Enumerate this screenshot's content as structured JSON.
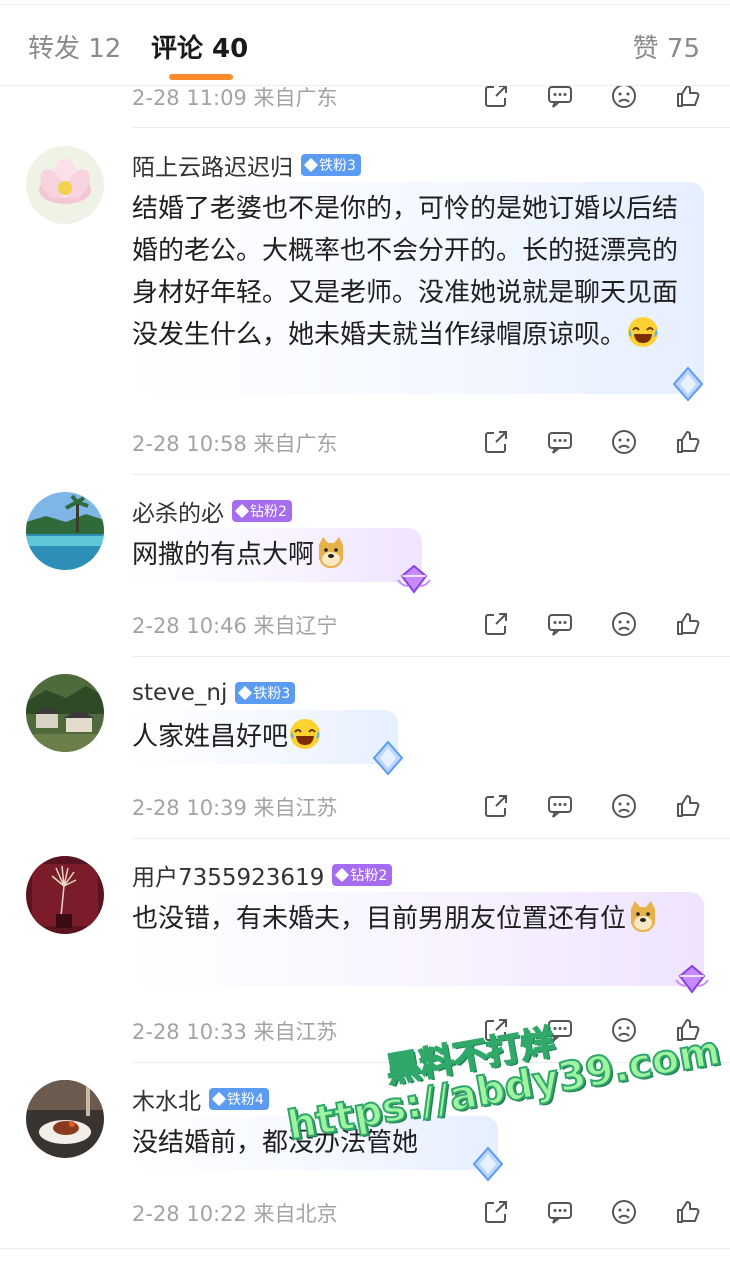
{
  "tabs": {
    "repost": "转发 12",
    "comment": "评论 40",
    "like": "赞 75"
  },
  "first_meta": {
    "time": "2-28 11:09 来自广东"
  },
  "comments": [
    {
      "user": "陌上云路迟迟归",
      "badge": "铁粉3",
      "badge_type": "iron",
      "text": "结婚了老婆也不是你的，可怜的是她订婚以后结婚的老公。大概率也不会分开的。长的挺漂亮的身材好年轻。又是老师。没准她说就是聊天见面没发生什么，她未婚夫就当作绿帽原谅呗。",
      "emoji": "laugh-cry",
      "meta": "2-28 10:58 来自广东"
    },
    {
      "user": "必杀的必",
      "badge": "钻粉2",
      "badge_type": "diamond",
      "text": "网撒的有点大啊",
      "emoji": "doge",
      "meta": "2-28 10:46 来自辽宁"
    },
    {
      "user": "steve_nj",
      "badge": "铁粉3",
      "badge_type": "iron",
      "text": "人家姓昌好吧",
      "emoji": "laugh-cry",
      "meta": "2-28 10:39 来自江苏"
    },
    {
      "user": "用户7355923619",
      "badge": "钻粉2",
      "badge_type": "diamond",
      "text": "也没错，有未婚夫，目前男朋友位置还有位",
      "emoji": "doge",
      "meta": "2-28 10:33 来自江苏"
    },
    {
      "user": "木水北",
      "badge": "铁粉4",
      "badge_type": "iron",
      "text": "没结婚前，都没办法管她",
      "emoji": "",
      "meta": "2-28 10:22 来自北京"
    }
  ],
  "icons": [
    "share-icon",
    "comment-icon",
    "dislike-icon",
    "like-icon"
  ],
  "watermark": {
    "line1": "黑料不打烊",
    "line2": "https://abdy39.com"
  },
  "colors": {
    "accent": "#ff8a2c",
    "iron_badge": "#5b9cf2",
    "diamond_badge": "#a56cf0"
  }
}
